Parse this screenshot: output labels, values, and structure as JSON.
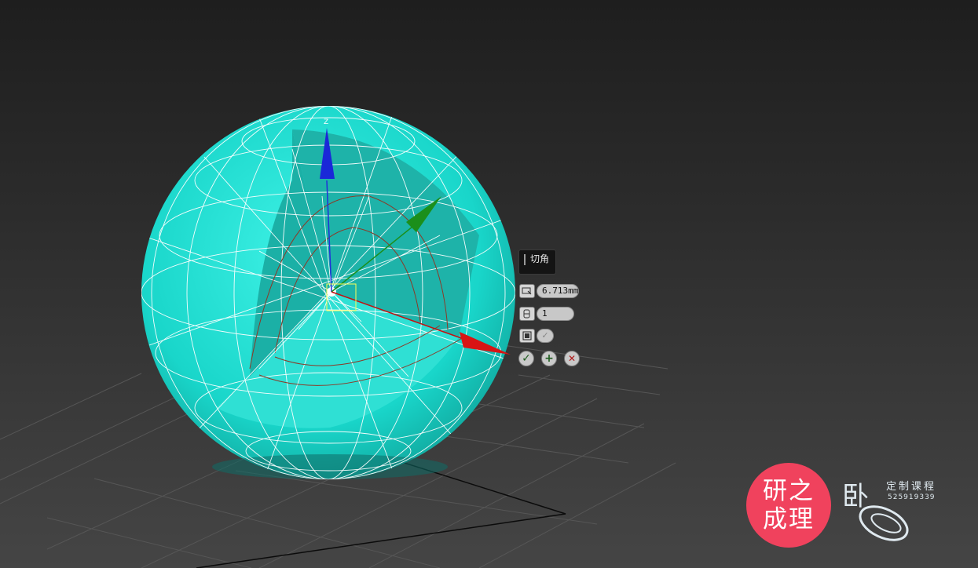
{
  "caddy": {
    "title": "切角",
    "amount_value": "6.713mm",
    "segments_value": "1",
    "toggle_glyph": "✓",
    "ok_glyph": "✓",
    "apply_glyph": "+",
    "cancel_glyph": "✕"
  },
  "gizmo": {
    "z_axis_label": "Z"
  },
  "watermark": {
    "circle_line1": "研之",
    "circle_line2": "成理",
    "logo_char": "卧",
    "tagline": "定制课程",
    "number": "525919339",
    "circle_color": "#f0425d"
  },
  "colors": {
    "sphere": "#21ddd2",
    "sphere_inner": "#1fb8ae",
    "grid": "#565656",
    "x_axis": "#d81414",
    "y_axis": "#1b8f1b",
    "z_axis": "#1a28d8",
    "selection": "#ffff55"
  },
  "icons": [
    "chamfer-amount-icon",
    "segments-icon",
    "smooth-icon",
    "ok-icon",
    "apply-icon",
    "cancel-icon",
    "seed-logo-icon"
  ]
}
